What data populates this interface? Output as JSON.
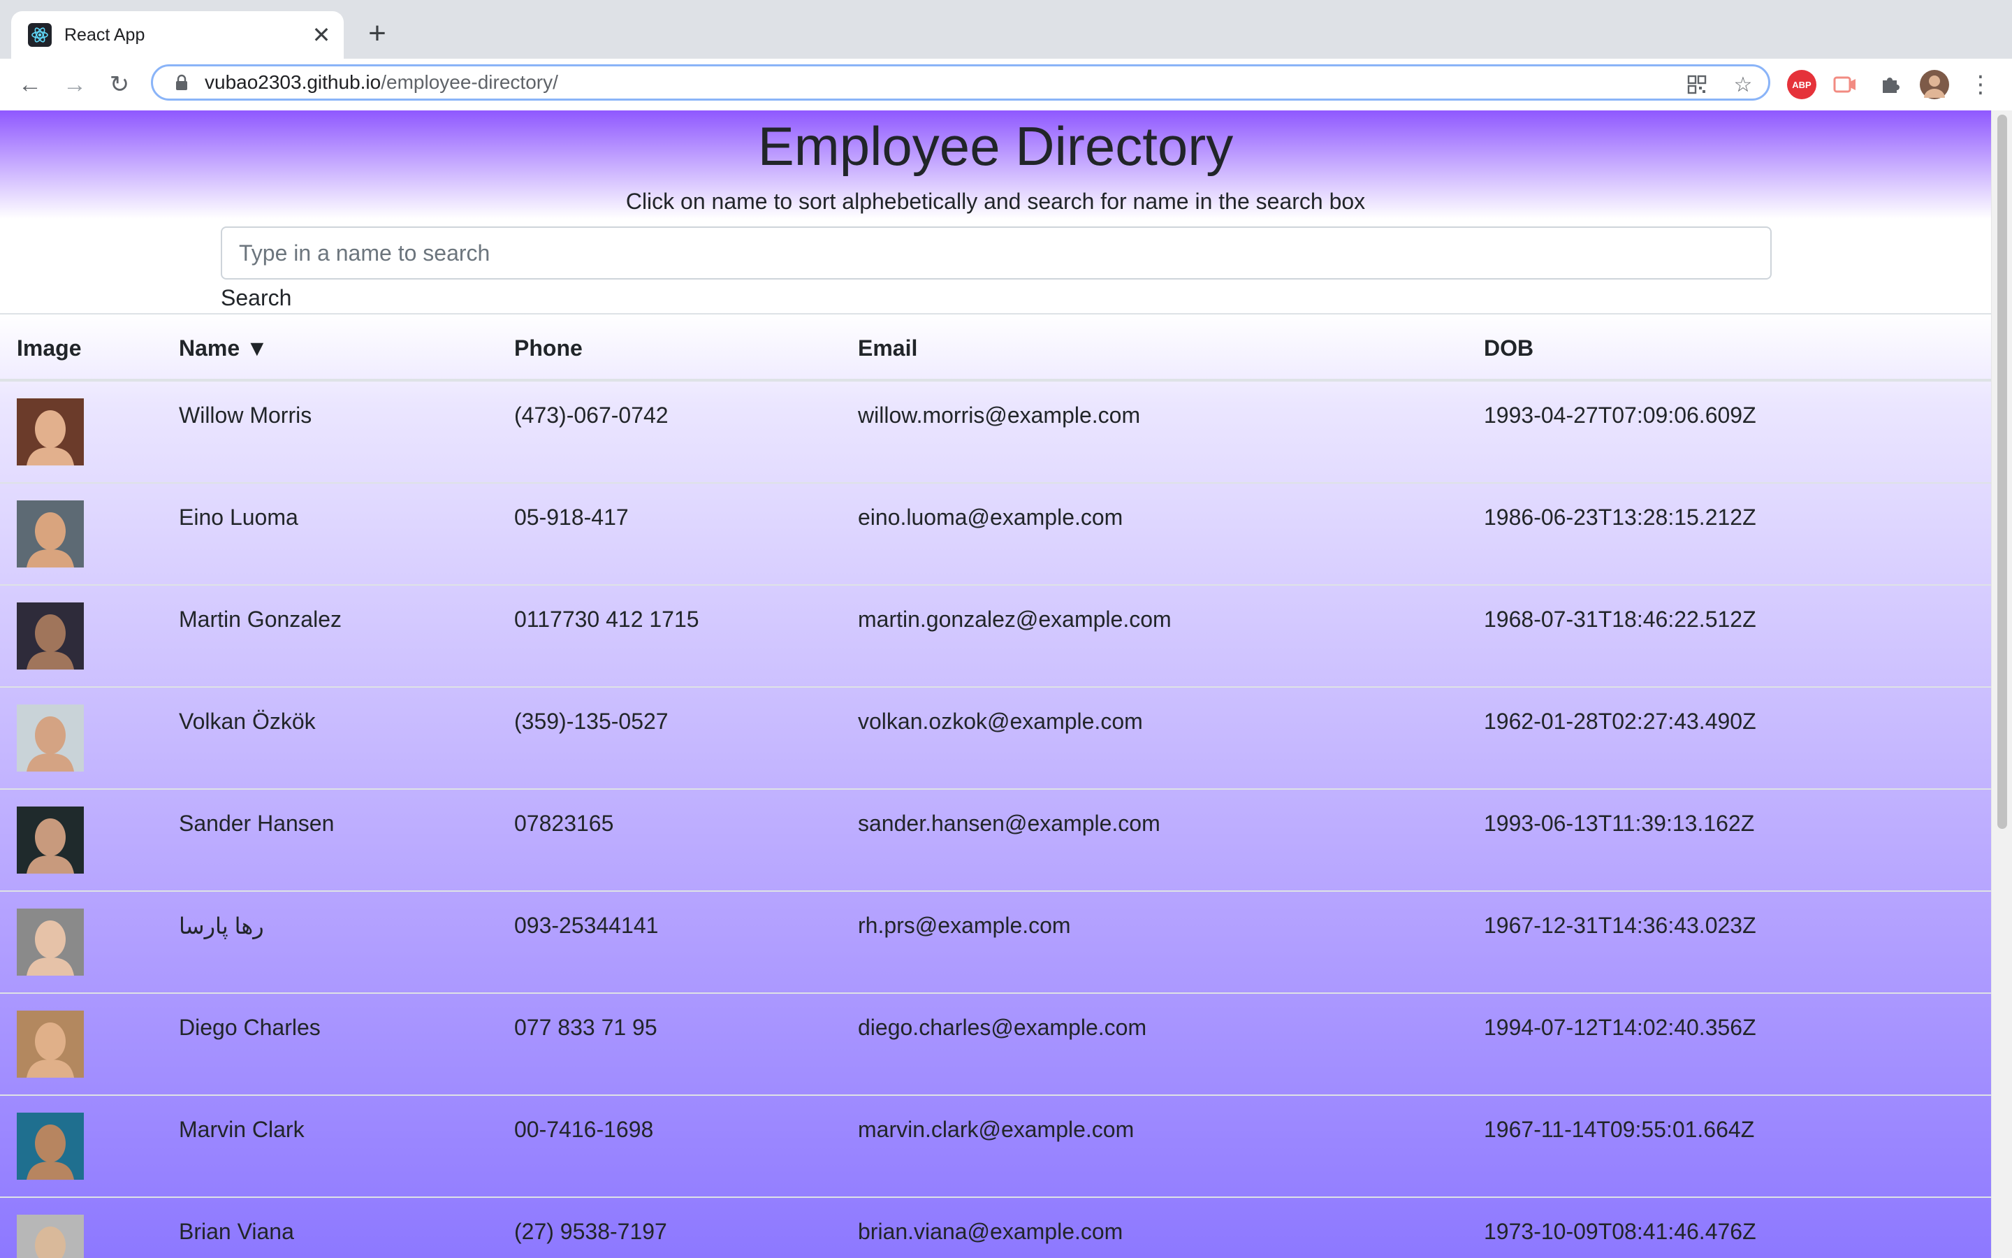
{
  "browser": {
    "tab_title": "React App",
    "url_host": "vubao2303.github.io",
    "url_path": "/employee-directory/"
  },
  "page": {
    "title": "Employee Directory",
    "subtitle": "Click on name to sort alphebetically and search for name in the search box",
    "search_placeholder": "Type in a name to search",
    "search_label": "Search"
  },
  "table": {
    "headers": {
      "image": "Image",
      "name": "Name ▼",
      "phone": "Phone",
      "email": "Email",
      "dob": "DOB"
    },
    "rows": [
      {
        "name": "Willow Morris",
        "phone": "(473)-067-0742",
        "email": "willow.morris@example.com",
        "dob": "1993-04-27T07:09:06.609Z",
        "avatar_bg": "#6b3b2a",
        "avatar_face": "#e2b08d"
      },
      {
        "name": "Eino Luoma",
        "phone": "05-918-417",
        "email": "eino.luoma@example.com",
        "dob": "1986-06-23T13:28:15.212Z",
        "avatar_bg": "#5d6a74",
        "avatar_face": "#d9a47e"
      },
      {
        "name": "Martin Gonzalez",
        "phone": "0117730 412 1715",
        "email": "martin.gonzalez@example.com",
        "dob": "1968-07-31T18:46:22.512Z",
        "avatar_bg": "#2e2b3a",
        "avatar_face": "#a0755b"
      },
      {
        "name": "Volkan Özkök",
        "phone": "(359)-135-0527",
        "email": "volkan.ozkok@example.com",
        "dob": "1962-01-28T02:27:43.490Z",
        "avatar_bg": "#c9d3d8",
        "avatar_face": "#d4a383"
      },
      {
        "name": "Sander Hansen",
        "phone": "07823165",
        "email": "sander.hansen@example.com",
        "dob": "1993-06-13T11:39:13.162Z",
        "avatar_bg": "#1f2a2c",
        "avatar_face": "#c89a7d"
      },
      {
        "name": "رها پارسا",
        "phone": "093-25344141",
        "email": "rh.prs@example.com",
        "dob": "1967-12-31T14:36:43.023Z",
        "avatar_bg": "#8a8a8a",
        "avatar_face": "#e6c2a8"
      },
      {
        "name": "Diego Charles",
        "phone": "077 833 71 95",
        "email": "diego.charles@example.com",
        "dob": "1994-07-12T14:02:40.356Z",
        "avatar_bg": "#b3885f",
        "avatar_face": "#e0b089"
      },
      {
        "name": "Marvin Clark",
        "phone": "00-7416-1698",
        "email": "marvin.clark@example.com",
        "dob": "1967-11-14T09:55:01.664Z",
        "avatar_bg": "#1f6f8f",
        "avatar_face": "#b78560"
      },
      {
        "name": "Brian Viana",
        "phone": "(27) 9538-7197",
        "email": "brian.viana@example.com",
        "dob": "1973-10-09T08:41:46.476Z",
        "avatar_bg": "#b7b7b7",
        "avatar_face": "#d9b99a"
      }
    ]
  },
  "colors": {
    "accent_purple": "#8f58ff",
    "omnibox_focus": "#8ab4f8"
  }
}
